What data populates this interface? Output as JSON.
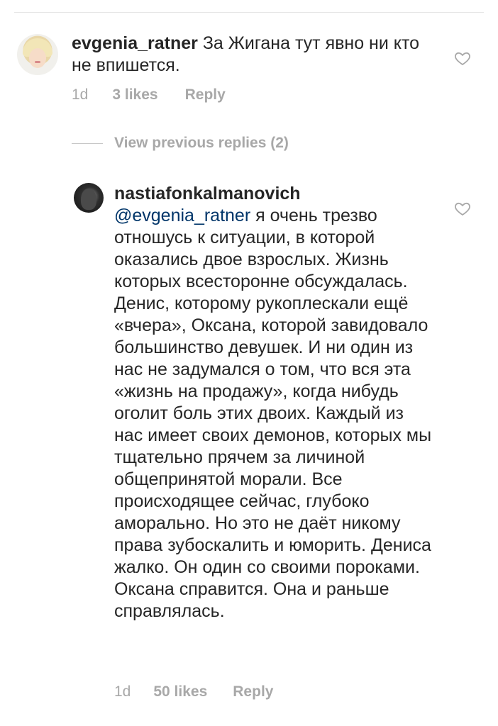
{
  "comments": [
    {
      "username": "evgenia_ratner",
      "text": "За Жигана тут явно ни кто не впишется.",
      "time": "1d",
      "likes": "3 likes",
      "reply_label": "Reply"
    },
    {
      "username": "nastiafonkalmanovich",
      "mention": "@evgenia_ratner",
      "text": "я очень трезво отношусь к ситуации, в которой оказались двое взрослых. Жизнь которых всесторонне обсуждалась. Денис, которому рукоплескали ещё «вчера», Оксана, которой завидовало большинство девушек. И ни один из нас не задумался о том, что вся эта «жизнь на продажу», когда нибудь оголит боль этих двоих. Каждый из нас имеет своих демонов, которых мы тщательно прячем за личиной общепринятой морали. Все происходящее сейчас, глубоко аморально. Но это не даёт никому права зубоскалить и юморить. Дениса жалко. Он один со своими пороками. Оксана справится. Она и раньше справлялась.",
      "time": "1d",
      "likes": "50 likes",
      "reply_label": "Reply"
    }
  ],
  "view_previous_replies": "View previous replies (2)",
  "icons": {
    "like": "heart-outline-icon"
  },
  "colors": {
    "text": "#262626",
    "muted": "#a8a8a8",
    "mention": "#003569"
  }
}
